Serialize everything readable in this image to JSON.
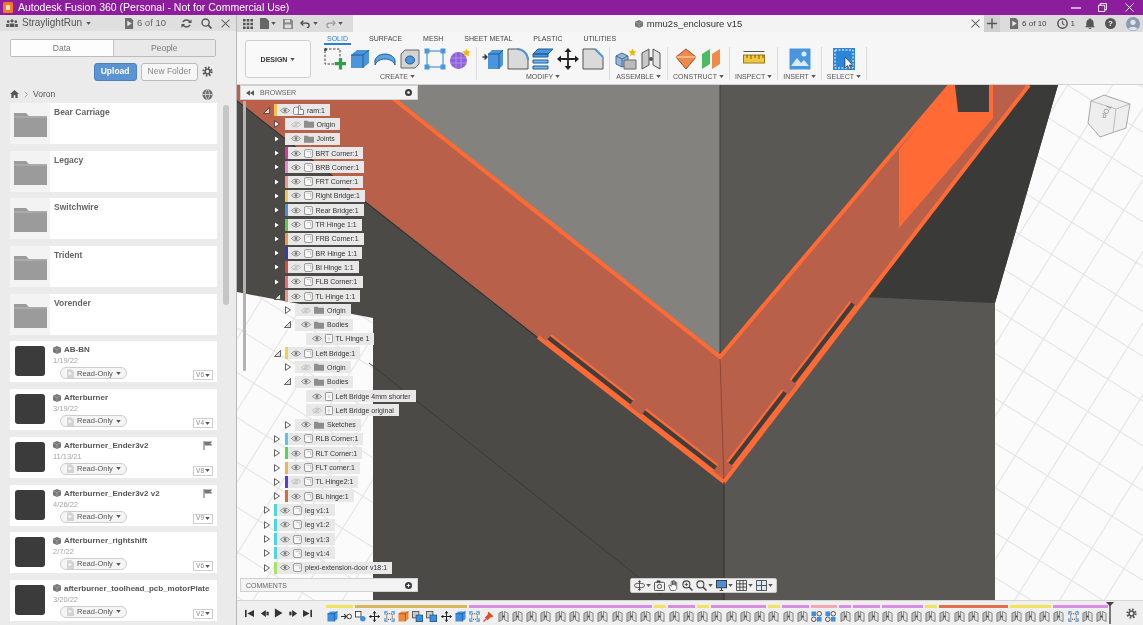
{
  "window": {
    "title": "Autodesk Fusion 360 (Personal - Not for Commercial Use)"
  },
  "data_panel": {
    "team": "StraylightRun",
    "open_documents": "6 of 10",
    "tabs": [
      {
        "label": "Data",
        "selected": true
      },
      {
        "label": "People",
        "selected": false
      }
    ],
    "buttons": [
      {
        "label": "Upload",
        "primary": true
      },
      {
        "label": "New Folder",
        "primary": false
      }
    ],
    "breadcrumb": [
      "Voron"
    ],
    "items": [
      {
        "kind": "folder",
        "name": "Bear Carriage"
      },
      {
        "kind": "folder",
        "name": "Legacy"
      },
      {
        "kind": "folder",
        "name": "Switchwire"
      },
      {
        "kind": "folder",
        "name": "Trident"
      },
      {
        "kind": "folder",
        "name": "Vorender"
      },
      {
        "kind": "design",
        "name": "AB-BN",
        "date": "1/19/22",
        "access": "Read-Only",
        "version": "V6",
        "milestone": false
      },
      {
        "kind": "design",
        "name": "Afterburner",
        "date": "3/19/22",
        "access": "Read-Only",
        "version": "V4",
        "milestone": false
      },
      {
        "kind": "design",
        "name": "Afterburner_Ender3v2",
        "date": "11/13/21",
        "access": "Read-Only",
        "version": "V8",
        "milestone": true
      },
      {
        "kind": "design",
        "name": "Afterburner_Ender3v2 v2",
        "date": "4/26/22",
        "access": "Read-Only",
        "version": "V9",
        "milestone": true
      },
      {
        "kind": "design",
        "name": "Afterburner_rightshift",
        "date": "2/7/22",
        "access": "Read-Only",
        "version": "V6",
        "milestone": false
      },
      {
        "kind": "design",
        "name": "afterburner_toolhead_pcb_motorPlate",
        "date": "3/20/22",
        "access": "Read-Only",
        "version": "V2",
        "milestone": false
      }
    ]
  },
  "document": {
    "title": "mmu2s_enclosure v15",
    "open_documents": "6 of 10",
    "clock_count": "1",
    "help": "?"
  },
  "ribbon": {
    "workspace": "DESIGN",
    "tabs": [
      {
        "label": "SOLID",
        "selected": true
      },
      {
        "label": "SURFACE",
        "selected": false
      },
      {
        "label": "MESH",
        "selected": false
      },
      {
        "label": "SHEET METAL",
        "selected": false
      },
      {
        "label": "PLASTIC",
        "selected": false
      },
      {
        "label": "UTILITIES",
        "selected": false
      }
    ],
    "groups": [
      {
        "label": "CREATE",
        "tools": [
          {
            "kind": "new-component"
          },
          {
            "kind": "extrude"
          },
          {
            "kind": "revolve"
          },
          {
            "kind": "hole"
          },
          {
            "kind": "pattern"
          },
          {
            "kind": "form"
          }
        ]
      },
      {
        "label": "MODIFY",
        "tools": [
          {
            "kind": "press-pull"
          },
          {
            "kind": "fillet"
          },
          {
            "kind": "shell"
          },
          {
            "kind": "move"
          },
          {
            "kind": "chamfer"
          }
        ]
      },
      {
        "label": "ASSEMBLE",
        "tools": [
          {
            "kind": "new-assembly-component"
          },
          {
            "kind": "joint"
          }
        ]
      },
      {
        "label": "CONSTRUCT",
        "tools": [
          {
            "kind": "offset-plane"
          },
          {
            "kind": "midplane"
          }
        ]
      },
      {
        "label": "INSPECT",
        "tools": [
          {
            "kind": "measure"
          }
        ]
      },
      {
        "label": "INSERT",
        "tools": [
          {
            "kind": "insert-image"
          }
        ]
      },
      {
        "label": "SELECT",
        "tools": [
          {
            "kind": "select"
          }
        ]
      }
    ]
  },
  "browser": {
    "title": "BROWSER",
    "tree": [
      {
        "kind": "active-component",
        "label": "ram:1",
        "color": "#f2c14e",
        "visible": true,
        "expanded": true,
        "children": [
          {
            "kind": "folder",
            "label": "Origin",
            "visible": false,
            "expanded": false
          },
          {
            "kind": "folder",
            "label": "Joints",
            "visible": true,
            "expanded": false
          },
          {
            "kind": "component",
            "label": "BRT Corner:1",
            "color": "#d63a9a",
            "visible": true,
            "expanded": false
          },
          {
            "kind": "component",
            "label": "BRB Corner:1",
            "color": "#ee86cf",
            "visible": true,
            "expanded": false
          },
          {
            "kind": "component",
            "label": "FRT Corner:1",
            "color": "#ec9a92",
            "visible": true,
            "expanded": false
          },
          {
            "kind": "component",
            "label": "Right Bridge:1",
            "color": "#efc84a",
            "visible": true,
            "expanded": false
          },
          {
            "kind": "component",
            "label": "Rear Bridge:1",
            "color": "#4f8fdc",
            "visible": true,
            "expanded": false
          },
          {
            "kind": "component",
            "label": "TR Hinge 1:1",
            "color": "#5dc94b",
            "visible": true,
            "expanded": false
          },
          {
            "kind": "component",
            "label": "FRB Corner:1",
            "color": "#e99a55",
            "visible": true,
            "expanded": false
          },
          {
            "kind": "component",
            "label": "BR Hinge 1:1",
            "color": "#3436c4",
            "visible": true,
            "expanded": false
          },
          {
            "kind": "component",
            "label": "Bl Hinge 1:1",
            "color": "#dc4a3c",
            "visible": false,
            "expanded": false
          },
          {
            "kind": "component",
            "label": "FLB Corner:1",
            "color": "#e8707c",
            "visible": true,
            "expanded": false
          },
          {
            "kind": "component",
            "label": "TL Hinge 1:1",
            "color": "#eb9484",
            "visible": true,
            "expanded": true,
            "children": [
              {
                "kind": "folder",
                "label": "Origin",
                "visible": false,
                "expanded": false
              },
              {
                "kind": "folder",
                "label": "Bodies",
                "visible": true,
                "expanded": true,
                "children": [
                  {
                    "kind": "body",
                    "label": "TL Hinge 1",
                    "visible": true
                  }
                ]
              }
            ]
          },
          {
            "kind": "component",
            "label": "Left Bridge:1",
            "color": "#f1d34a",
            "visible": true,
            "expanded": true,
            "children": [
              {
                "kind": "folder",
                "label": "Origin",
                "visible": false,
                "expanded": false
              },
              {
                "kind": "folder",
                "label": "Bodies",
                "visible": true,
                "expanded": true,
                "children": [
                  {
                    "kind": "body",
                    "label": "Left Bridge 4mm shorter",
                    "visible": true
                  },
                  {
                    "kind": "body",
                    "label": "Left Bridge original",
                    "visible": false
                  }
                ]
              },
              {
                "kind": "folder",
                "label": "Sketches",
                "visible": true,
                "expanded": false
              }
            ]
          },
          {
            "kind": "component",
            "label": "RLB Corner:1",
            "color": "#5cc4ec",
            "visible": true,
            "expanded": false
          },
          {
            "kind": "component",
            "label": "RLT Corner:1",
            "color": "#55d84e",
            "visible": true,
            "expanded": false
          },
          {
            "kind": "component",
            "label": "FLT corner:1",
            "color": "#f2b24e",
            "visible": true,
            "expanded": false
          },
          {
            "kind": "component",
            "label": "TL Hinge2:1",
            "color": "#5a3ed2",
            "visible": false,
            "expanded": false
          },
          {
            "kind": "component",
            "label": "BL hinge:1",
            "color": "#e4663a",
            "visible": true,
            "expanded": false
          }
        ]
      },
      {
        "kind": "component",
        "label": "leg v1:1",
        "color": "#4ed6dc",
        "visible": true,
        "expanded": false
      },
      {
        "kind": "component",
        "label": "leg v1:2",
        "color": "#4ed6dc",
        "visible": true,
        "expanded": false
      },
      {
        "kind": "component",
        "label": "leg v1:3",
        "color": "#4ed6dc",
        "visible": true,
        "expanded": false
      },
      {
        "kind": "component",
        "label": "leg v1:4",
        "color": "#4ed6dc",
        "visible": true,
        "expanded": false
      },
      {
        "kind": "component",
        "label": "plexi-extension-door v18:1",
        "color": "#a8e264",
        "visible": true,
        "expanded": false
      }
    ]
  },
  "comments": {
    "title": "COMMENTS"
  },
  "viewcube": {
    "face": "TOP"
  },
  "navigation_bar": {
    "tools": [
      {
        "kind": "orbit",
        "menu": true
      },
      {
        "kind": "look-at",
        "menu": false
      },
      {
        "kind": "pan",
        "menu": false
      },
      {
        "kind": "zoom",
        "menu": false
      },
      {
        "kind": "zoom-window",
        "menu": true
      },
      {
        "kind": "display",
        "menu": true
      },
      {
        "kind": "grid",
        "menu": true
      },
      {
        "kind": "viewports",
        "menu": true
      }
    ]
  },
  "timeline": {
    "groups": [
      {
        "color": "#f2e35c",
        "features": [
          {
            "kind": "body"
          },
          {
            "kind": "joint-origin"
          }
        ]
      },
      {
        "color": "#d8b65a",
        "features": [
          {
            "kind": "components"
          },
          {
            "kind": "move"
          },
          {
            "kind": "sketch"
          },
          {
            "kind": "extrude"
          },
          {
            "kind": "combine"
          },
          {
            "kind": "combine"
          },
          {
            "kind": "move"
          },
          {
            "kind": "body"
          }
        ]
      },
      {
        "color": "#d98de3",
        "features": [
          {
            "kind": "sketch"
          },
          {
            "kind": "pin"
          },
          {
            "kind": "joint"
          },
          {
            "kind": "joint"
          },
          {
            "kind": "joint"
          },
          {
            "kind": "joint"
          },
          {
            "kind": "joint"
          },
          {
            "kind": "joint"
          },
          {
            "kind": "joint"
          },
          {
            "kind": "joint"
          },
          {
            "kind": "joint"
          },
          {
            "kind": "joint"
          },
          {
            "kind": "joint"
          }
        ]
      },
      {
        "color": "#f2e35c",
        "features": [
          {
            "kind": "joint"
          }
        ]
      },
      {
        "color": "#d98de3",
        "features": [
          {
            "kind": "joint"
          },
          {
            "kind": "joint"
          }
        ]
      },
      {
        "color": "#f2e35c",
        "features": [
          {
            "kind": "joint"
          }
        ]
      },
      {
        "color": "#d98de3",
        "features": [
          {
            "kind": "joint"
          },
          {
            "kind": "joint"
          },
          {
            "kind": "joint"
          },
          {
            "kind": "joint"
          }
        ]
      },
      {
        "color": "#f2e35c",
        "features": [
          {
            "kind": "joint"
          }
        ]
      },
      {
        "color": "#d98de3",
        "features": [
          {
            "kind": "joint"
          },
          {
            "kind": "joint"
          }
        ]
      },
      {
        "color": "#f2a9b4",
        "features": [
          {
            "kind": "rigid-group"
          },
          {
            "kind": "rigid-group"
          }
        ]
      },
      {
        "color": "#d98de3",
        "features": [
          {
            "kind": "joint"
          }
        ]
      },
      {
        "color": "#d98de3",
        "features": [
          {
            "kind": "joint"
          },
          {
            "kind": "joint"
          }
        ]
      },
      {
        "color": "#d98de3",
        "features": [
          {
            "kind": "joint"
          },
          {
            "kind": "joint"
          },
          {
            "kind": "joint"
          }
        ]
      },
      {
        "color": "#f2e35c",
        "features": [
          {
            "kind": "joint"
          }
        ]
      },
      {
        "color": "#e0704e",
        "features": [
          {
            "kind": "joint"
          },
          {
            "kind": "joint"
          },
          {
            "kind": "joint"
          },
          {
            "kind": "joint"
          },
          {
            "kind": "joint"
          }
        ]
      },
      {
        "color": "#f2e35c",
        "features": [
          {
            "kind": "joint"
          },
          {
            "kind": "joint"
          },
          {
            "kind": "joint"
          }
        ]
      },
      {
        "color": "#d98de3",
        "features": [
          {
            "kind": "joint"
          },
          {
            "kind": "sketch"
          },
          {
            "kind": "joint"
          },
          {
            "kind": "joint"
          }
        ]
      }
    ]
  }
}
